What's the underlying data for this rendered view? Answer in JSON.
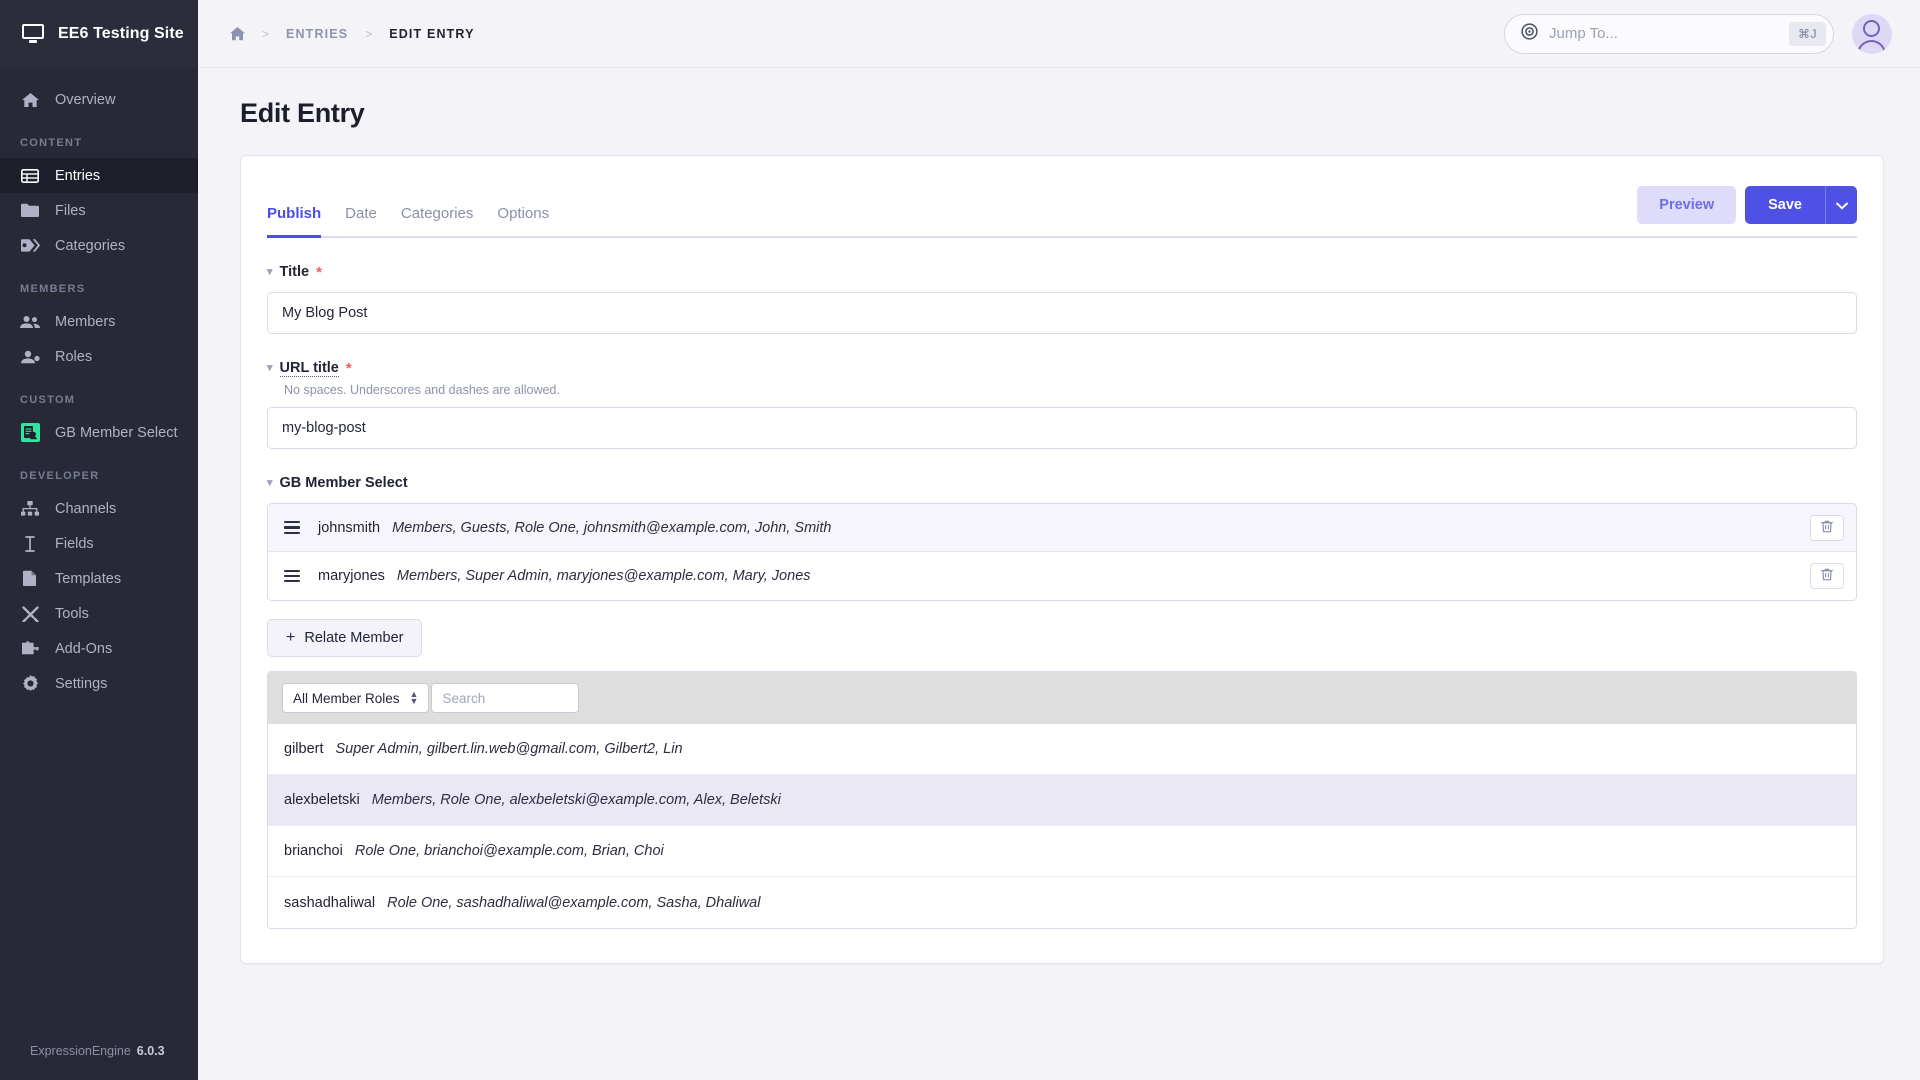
{
  "sidebar": {
    "site_name": "EE6 Testing Site",
    "site_icon": "monitor-icon",
    "overview": {
      "label": "Overview",
      "icon": "home-icon"
    },
    "groups": [
      {
        "label": "CONTENT",
        "items": [
          {
            "label": "Entries",
            "icon": "table-icon",
            "active": true
          },
          {
            "label": "Files",
            "icon": "folder-icon",
            "active": false
          },
          {
            "label": "Categories",
            "icon": "tag-icon",
            "active": false
          }
        ]
      },
      {
        "label": "MEMBERS",
        "items": [
          {
            "label": "Members",
            "icon": "people-icon",
            "active": false
          },
          {
            "label": "Roles",
            "icon": "person-badge-icon",
            "active": false
          }
        ]
      },
      {
        "label": "CUSTOM",
        "items": [
          {
            "label": "GB Member Select",
            "icon": "gb-member-select-icon",
            "active": false
          }
        ]
      },
      {
        "label": "DEVELOPER",
        "items": [
          {
            "label": "Channels",
            "icon": "sitemap-icon",
            "active": false
          },
          {
            "label": "Fields",
            "icon": "text-cursor-icon",
            "active": false
          },
          {
            "label": "Templates",
            "icon": "file-icon",
            "active": false
          },
          {
            "label": "Tools",
            "icon": "tools-icon",
            "active": false
          },
          {
            "label": "Add-Ons",
            "icon": "puzzle-icon",
            "active": false
          },
          {
            "label": "Settings",
            "icon": "gear-icon",
            "active": false
          }
        ]
      }
    ],
    "footer": {
      "product": "ExpressionEngine",
      "version": "6.0.3"
    }
  },
  "topbar": {
    "breadcrumb": {
      "home_icon": "home-icon",
      "separator": ">",
      "items": [
        "ENTRIES",
        "EDIT ENTRY"
      ]
    },
    "jump_to": {
      "placeholder": "Jump To...",
      "icon": "target-icon",
      "shortcut": "⌘J"
    },
    "avatar": "user-avatar"
  },
  "page": {
    "title": "Edit Entry"
  },
  "tabs": [
    {
      "label": "Publish",
      "active": true
    },
    {
      "label": "Date",
      "active": false
    },
    {
      "label": "Categories",
      "active": false
    },
    {
      "label": "Options",
      "active": false
    }
  ],
  "actions": {
    "preview": "Preview",
    "save": "Save",
    "save_caret_icon": "chevron-down-icon"
  },
  "fields": {
    "title": {
      "label": "Title",
      "required_mark": "*",
      "value": "My Blog Post"
    },
    "url_title": {
      "label": "URL title",
      "required_mark": "*",
      "hint": "No spaces. Underscores and dashes are allowed.",
      "value": "my-blog-post"
    },
    "gb_member_select": {
      "label": "GB Member Select",
      "related": [
        {
          "username": "johnsmith",
          "meta": "Members, Guests, Role One, johnsmith@example.com, John, Smith",
          "delete_icon": "trash-icon"
        },
        {
          "username": "maryjones",
          "meta": "Members, Super Admin, maryjones@example.com, Mary, Jones",
          "delete_icon": "trash-icon"
        }
      ],
      "relate_button": {
        "label": "Relate Member",
        "icon": "plus-icon"
      },
      "picker": {
        "role_filter": {
          "value": "All Member Roles",
          "icon": "stepper-icon"
        },
        "search": {
          "placeholder": "Search",
          "value": ""
        },
        "options": [
          {
            "username": "gilbert",
            "meta": "Super Admin, gilbert.lin.web@gmail.com, Gilbert2, Lin",
            "highlighted": false
          },
          {
            "username": "alexbeletski",
            "meta": "Members, Role One, alexbeletski@example.com, Alex, Beletski",
            "highlighted": true
          },
          {
            "username": "brianchoi",
            "meta": "Role One, brianchoi@example.com, Brian, Choi",
            "highlighted": false
          },
          {
            "username": "sashadhaliwal",
            "meta": "Role One, sashadhaliwal@example.com, Sasha, Dhaliwal",
            "highlighted": false
          }
        ]
      }
    }
  },
  "colors": {
    "sidebar_bg": "#272936",
    "accent": "#4f50e6",
    "accent_soft": "#dedcfa",
    "required": "#f05a54",
    "custom_icon": "#2ee6a0",
    "page_bg": "#f4f4f8"
  }
}
